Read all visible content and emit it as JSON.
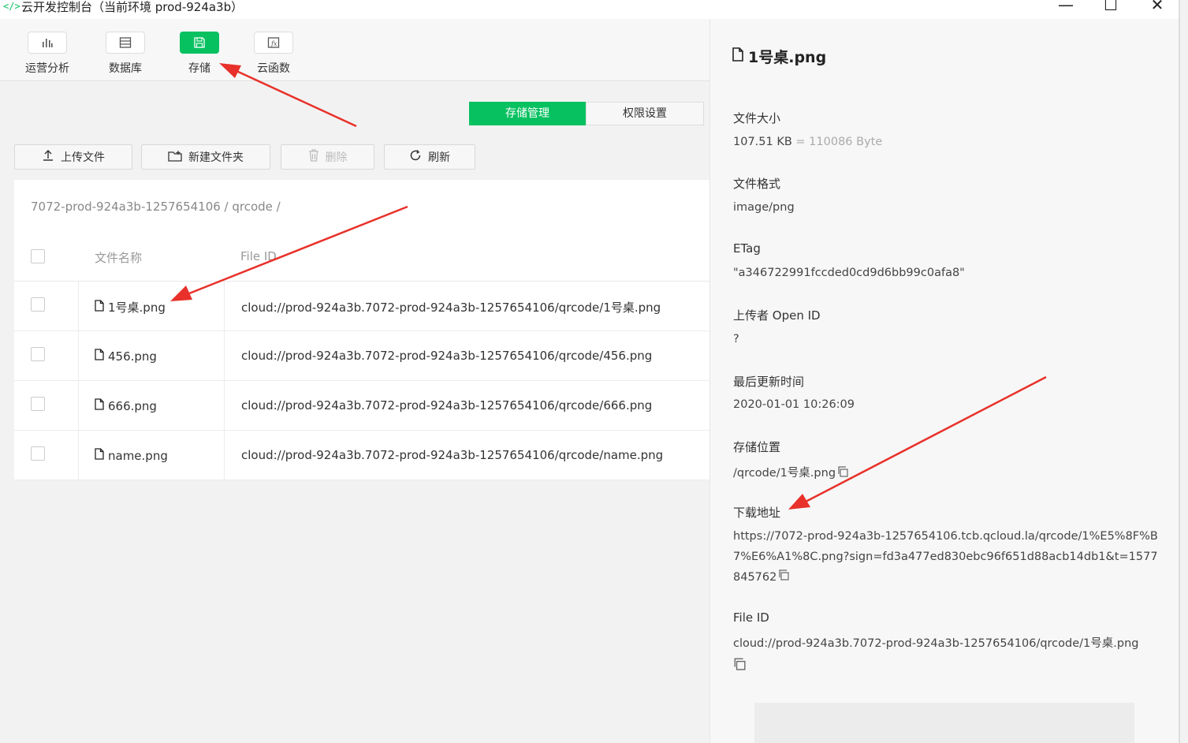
{
  "window": {
    "title": "云开发控制台（当前环境 prod-924a3b）",
    "minimize": "—",
    "maximize": "☐",
    "close": "✕"
  },
  "toolbar": {
    "items": [
      {
        "label": "运营分析",
        "icon": "bar-chart-icon"
      },
      {
        "label": "数据库",
        "icon": "database-icon"
      },
      {
        "label": "存储",
        "icon": "floppy-disk-icon",
        "active": true
      },
      {
        "label": "云函数",
        "icon": "function-icon"
      }
    ]
  },
  "tabs": {
    "storage_manage": "存储管理",
    "permission_settings": "权限设置"
  },
  "actions": {
    "upload": "上传文件",
    "new_folder": "新建文件夹",
    "delete": "删除",
    "refresh": "刷新"
  },
  "breadcrumb": {
    "path": "7072-prod-924a3b-1257654106 / qrcode /"
  },
  "table": {
    "columns": [
      "文件名称",
      "File ID"
    ],
    "rows": [
      {
        "name": "1号桌.png",
        "file_id": "cloud://prod-924a3b.7072-prod-924a3b-1257654106/qrcode/1号桌.png"
      },
      {
        "name": "456.png",
        "file_id": "cloud://prod-924a3b.7072-prod-924a3b-1257654106/qrcode/456.png"
      },
      {
        "name": "666.png",
        "file_id": "cloud://prod-924a3b.7072-prod-924a3b-1257654106/qrcode/666.png"
      },
      {
        "name": "name.png",
        "file_id": "cloud://prod-924a3b.7072-prod-924a3b-1257654106/qrcode/name.png"
      }
    ]
  },
  "detail": {
    "title": "1号桌.png",
    "size_label": "文件大小",
    "size_value": "107.51 KB",
    "size_bytes": "= 110086 Byte",
    "format_label": "文件格式",
    "format_value": "image/png",
    "etag_label": "ETag",
    "etag_value": "\"a346722991fccded0cd9d6bb99c0afa8\"",
    "uploader_label": "上传者 Open ID",
    "uploader_value": "?",
    "updated_label": "最后更新时间",
    "updated_value": "2020-01-01 10:26:09",
    "location_label": "存储位置",
    "location_value": "/qrcode/1号桌.png",
    "download_label": "下载地址",
    "download_value": "https://7072-prod-924a3b-1257654106.tcb.qcloud.la/qrcode/1%E5%8F%B7%E6%A1%8C.png?sign=fd3a477ed830ebc96f651d88acb14db1&t=1577845762",
    "fileid_label": "File ID",
    "fileid_value": "cloud://prod-924a3b.7072-prod-924a3b-1257654106/qrcode/1号桌.png"
  },
  "colors": {
    "accent": "#07c160",
    "annotation": "#e8312a"
  }
}
